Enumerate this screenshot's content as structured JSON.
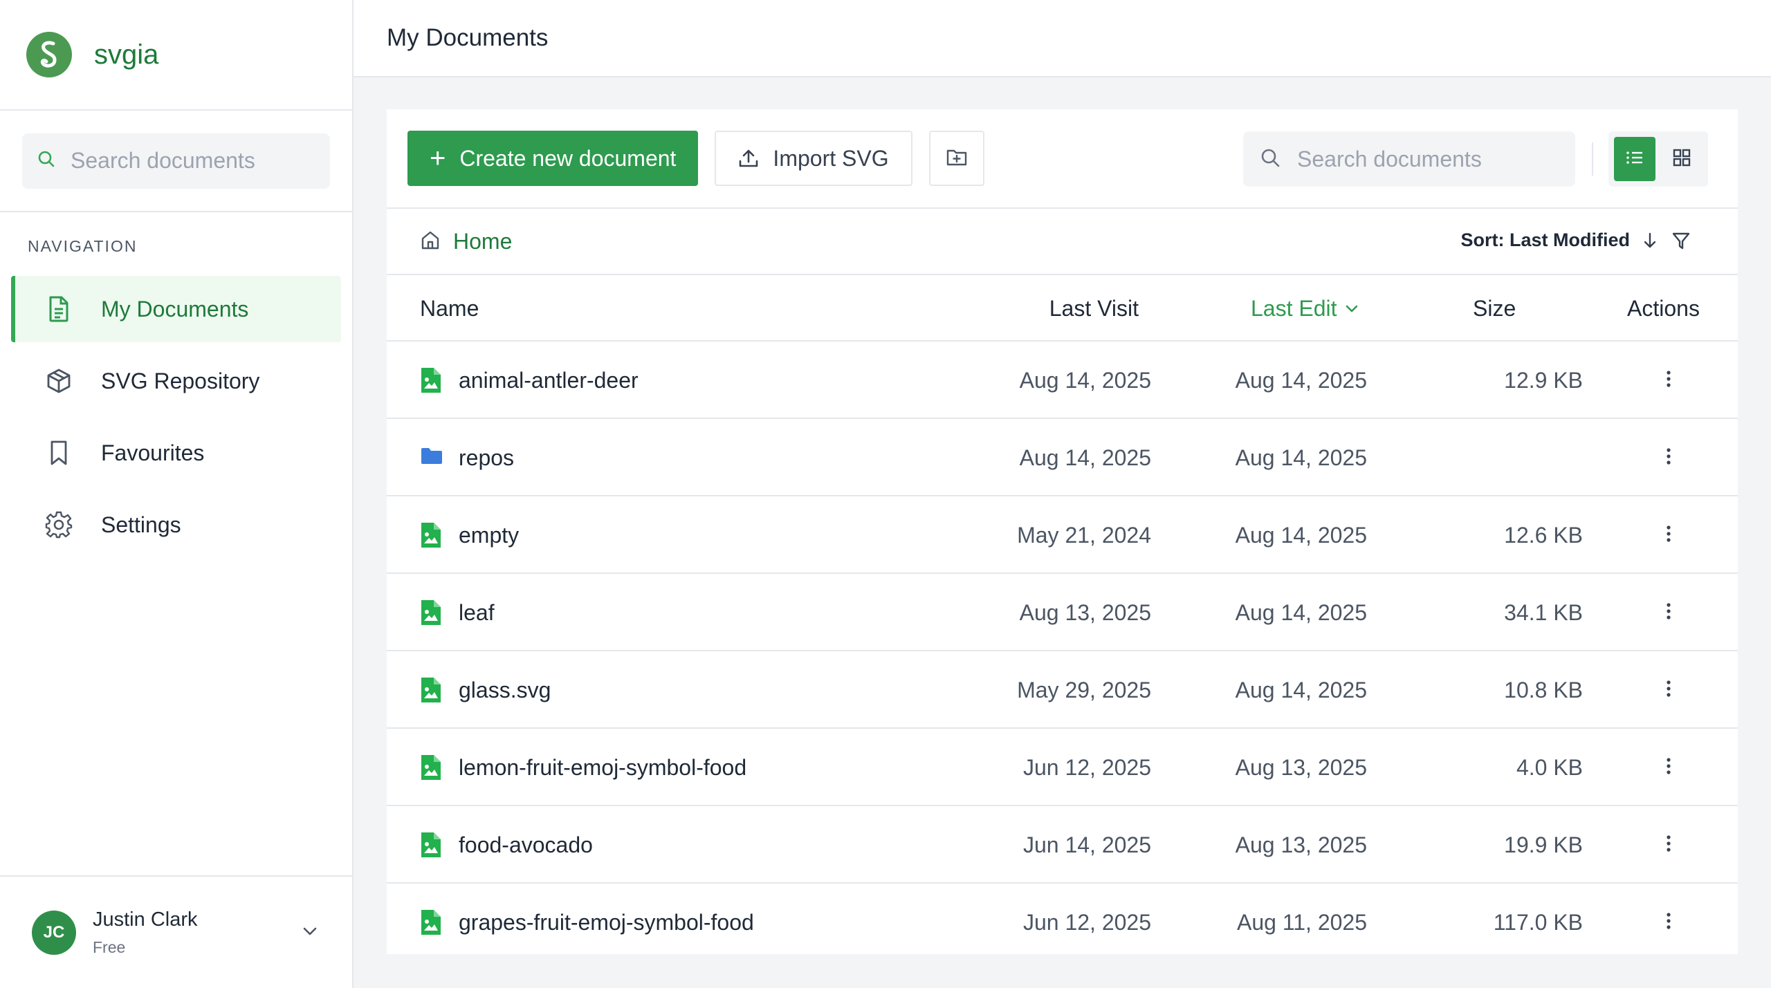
{
  "brand": {
    "name": "svgia",
    "accent": "#2e9b4f",
    "logo_icon": "s-logo-icon"
  },
  "sidebar": {
    "search_placeholder": "Search documents",
    "nav_heading": "NAVIGATION",
    "items": [
      {
        "label": "My Documents",
        "icon": "document-icon",
        "active": true
      },
      {
        "label": "SVG Repository",
        "icon": "cube-icon",
        "active": false
      },
      {
        "label": "Favourites",
        "icon": "bookmark-icon",
        "active": false
      },
      {
        "label": "Settings",
        "icon": "gear-icon",
        "active": false
      }
    ],
    "user": {
      "initials": "JC",
      "name": "Justin Clark",
      "plan": "Free"
    }
  },
  "header": {
    "title": "My Documents"
  },
  "toolbar": {
    "create_label": "Create new document",
    "import_label": "Import SVG",
    "search_placeholder": "Search documents",
    "view_mode": "list"
  },
  "breadcrumb": {
    "home_label": "Home"
  },
  "sort": {
    "label": "Sort: Last Modified",
    "direction": "descending"
  },
  "table": {
    "columns": {
      "name": "Name",
      "last_visit": "Last Visit",
      "last_edit": "Last Edit",
      "size": "Size",
      "actions": "Actions"
    },
    "rows": [
      {
        "type": "file",
        "name": "animal-antler-deer",
        "last_visit": "Aug 14, 2025",
        "last_edit": "Aug 14, 2025",
        "size": "12.9 KB"
      },
      {
        "type": "folder",
        "name": "repos",
        "last_visit": "Aug 14, 2025",
        "last_edit": "Aug 14, 2025",
        "size": ""
      },
      {
        "type": "file",
        "name": "empty",
        "last_visit": "May 21, 2024",
        "last_edit": "Aug 14, 2025",
        "size": "12.6 KB"
      },
      {
        "type": "file",
        "name": "leaf",
        "last_visit": "Aug 13, 2025",
        "last_edit": "Aug 14, 2025",
        "size": "34.1 KB"
      },
      {
        "type": "file",
        "name": "glass.svg",
        "last_visit": "May 29, 2025",
        "last_edit": "Aug 14, 2025",
        "size": "10.8 KB"
      },
      {
        "type": "file",
        "name": "lemon-fruit-emoj-symbol-food",
        "last_visit": "Jun 12, 2025",
        "last_edit": "Aug 13, 2025",
        "size": "4.0 KB"
      },
      {
        "type": "file",
        "name": "food-avocado",
        "last_visit": "Jun 14, 2025",
        "last_edit": "Aug 13, 2025",
        "size": "19.9 KB"
      },
      {
        "type": "file",
        "name": "grapes-fruit-emoj-symbol-food",
        "last_visit": "Jun 12, 2025",
        "last_edit": "Aug 11, 2025",
        "size": "117.0 KB"
      }
    ]
  },
  "colors": {
    "file_icon": "#22b14c",
    "folder_icon": "#3b7ddd"
  }
}
